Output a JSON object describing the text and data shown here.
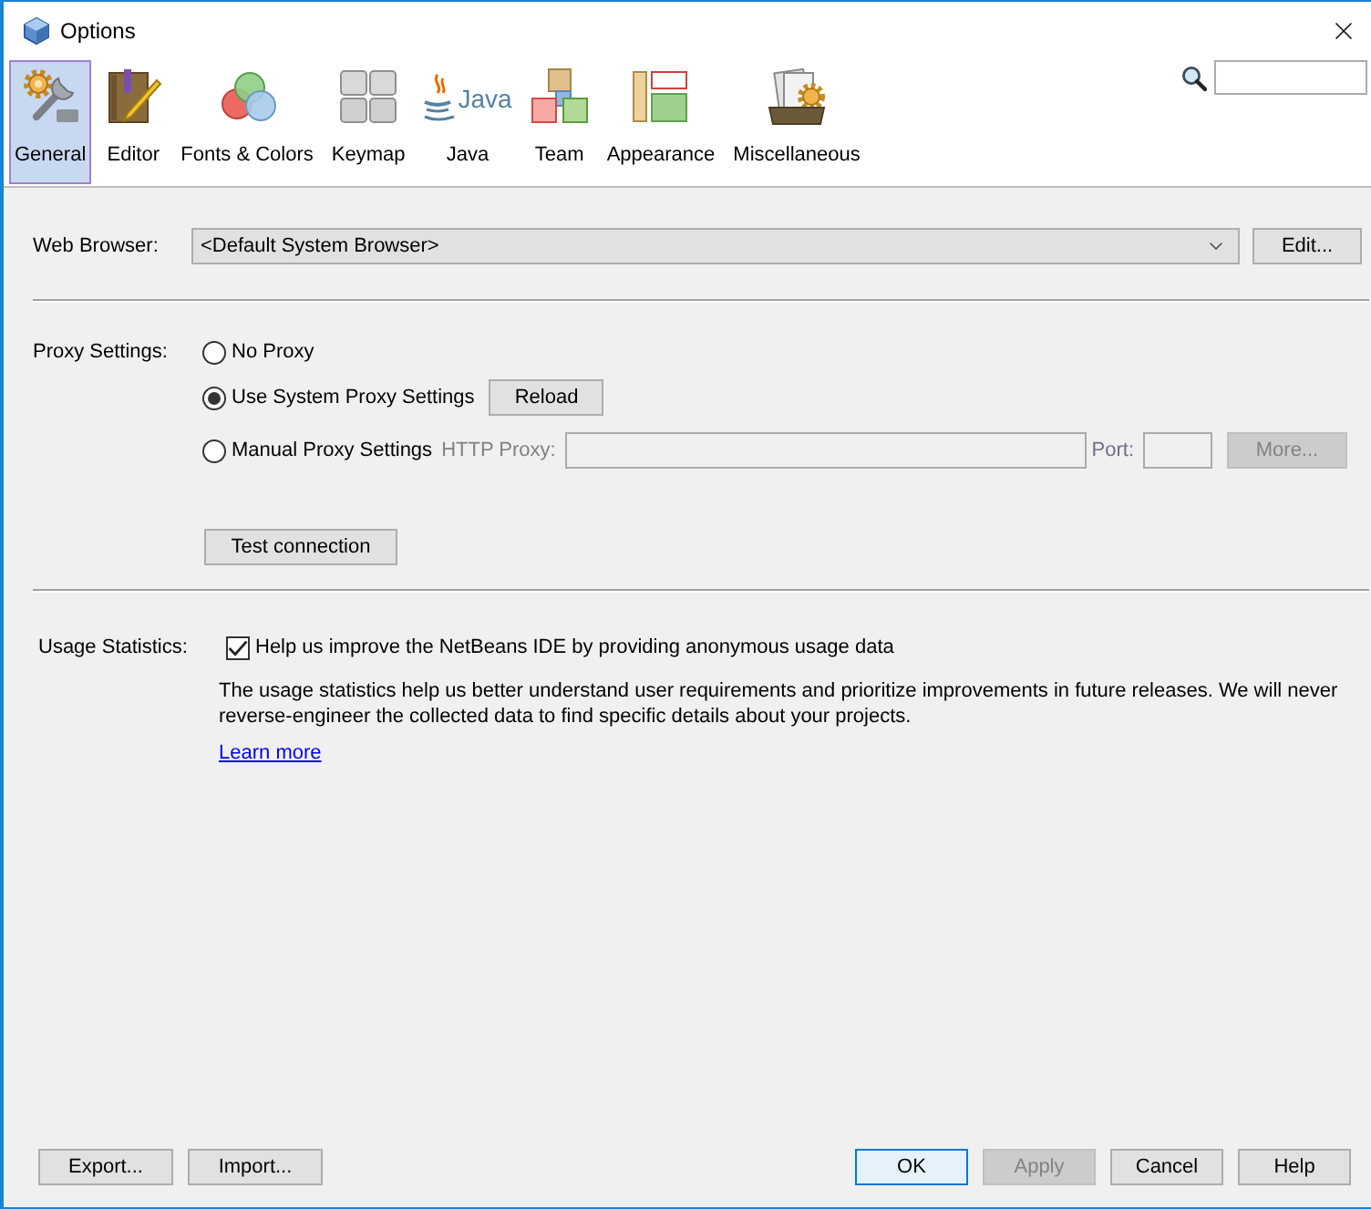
{
  "window": {
    "title": "Options"
  },
  "categories": [
    {
      "label": "General",
      "selected": true
    },
    {
      "label": "Editor",
      "selected": false
    },
    {
      "label": "Fonts & Colors",
      "selected": false
    },
    {
      "label": "Keymap",
      "selected": false
    },
    {
      "label": "Java",
      "selected": false,
      "logo_text": "Java"
    },
    {
      "label": "Team",
      "selected": false
    },
    {
      "label": "Appearance",
      "selected": false
    },
    {
      "label": "Miscellaneous",
      "selected": false
    }
  ],
  "web_browser": {
    "label": "Web Browser:",
    "value": "<Default System Browser>",
    "edit_button": {
      "label": "Edit...",
      "disabled": false
    }
  },
  "proxy": {
    "label": "Proxy Settings:",
    "options": [
      {
        "label": "No Proxy",
        "selected": false
      },
      {
        "label": "Use System Proxy Settings",
        "selected": true
      },
      {
        "label": "Manual Proxy Settings",
        "selected": false
      }
    ],
    "reload_button": {
      "label": "Reload",
      "disabled": false
    },
    "http_proxy": {
      "label": "HTTP Proxy:",
      "disabled": true
    },
    "port": {
      "label": "Port:",
      "disabled": true
    },
    "more_button": {
      "label": "More...",
      "disabled": true
    },
    "test_button": {
      "label": "Test connection",
      "disabled": false
    }
  },
  "usage_statistics": {
    "label": "Usage Statistics:",
    "checkbox": {
      "label": "Help us improve the NetBeans IDE by providing anonymous usage data",
      "checked": true
    },
    "description": "The usage statistics help us better understand user requirements and prioritize improvements in future releases. We will never reverse-engineer the collected data to find specific details about your projects.",
    "link": "Learn more"
  },
  "footer": {
    "left_buttons": [
      {
        "label": "Export...",
        "disabled": false,
        "focused": false
      },
      {
        "label": "Import...",
        "disabled": false,
        "focused": false
      }
    ],
    "right_buttons": [
      {
        "label": "OK",
        "disabled": false,
        "focused": true
      },
      {
        "label": "Apply",
        "disabled": true,
        "focused": false
      },
      {
        "label": "Cancel",
        "disabled": false,
        "focused": false
      },
      {
        "label": "Help",
        "disabled": false,
        "focused": false
      }
    ]
  }
}
